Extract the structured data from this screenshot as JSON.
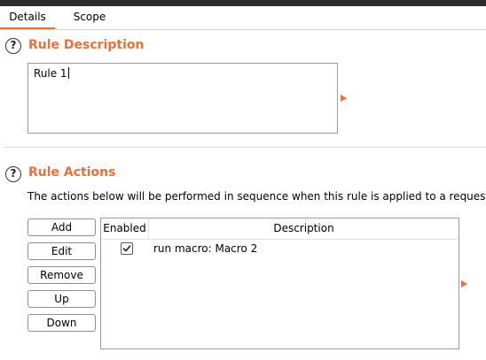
{
  "tabs": [
    {
      "label": "Details",
      "active": true
    },
    {
      "label": "Scope",
      "active": false
    }
  ],
  "rule_description": {
    "title": "Rule Description",
    "value": "Rule 1"
  },
  "rule_actions": {
    "title": "Rule Actions",
    "description": "The actions below will be performed in sequence when this rule is applied to a request.",
    "buttons": {
      "add": "Add",
      "edit": "Edit",
      "remove": "Remove",
      "up": "Up",
      "down": "Down"
    },
    "table": {
      "columns": [
        "Enabled",
        "Description"
      ],
      "rows": [
        {
          "enabled": true,
          "description": "run macro: Macro 2"
        }
      ]
    }
  },
  "icons": {
    "help": "help-icon",
    "expand": "expand-arrow-icon",
    "check": "check-icon"
  },
  "help_glyph": "?",
  "colors": {
    "accent": "#e8703a",
    "top_bar": "#2c2c2c"
  }
}
